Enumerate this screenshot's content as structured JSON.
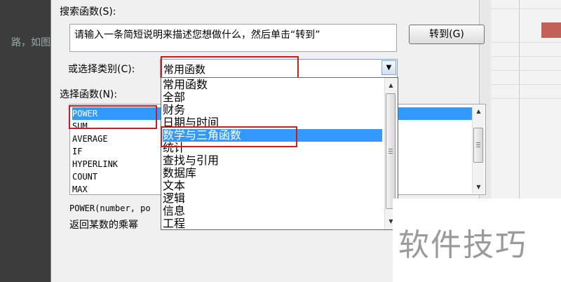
{
  "background": {
    "left_text": "路，如图"
  },
  "dialog": {
    "search_label": "搜索函数(S):",
    "search_value": "请输入一条简短说明来描述您想做什么，然后单击“转到”",
    "go_button": "转到(G)",
    "category_label": "或选择类别(C):",
    "category_value": "常用函数",
    "function_label": "选择函数(N):",
    "functions": [
      "POWER",
      "SUM",
      "AVERAGE",
      "IF",
      "HYPERLINK",
      "COUNT",
      "MAX"
    ],
    "selected_function": "POWER",
    "signature": "POWER(number, po",
    "description": "返回某数的乘幂"
  },
  "dropdown": {
    "options": [
      "常用函数",
      "全部",
      "财务",
      "日期与时间",
      "数学与三角函数",
      "统计",
      "查找与引用",
      "数据库",
      "文本",
      "逻辑",
      "信息",
      "工程"
    ],
    "highlighted": "数学与三角函数"
  },
  "watermark": "软件技巧",
  "colors": {
    "highlight": "#3399ff",
    "annotation": "#c81e1e"
  }
}
